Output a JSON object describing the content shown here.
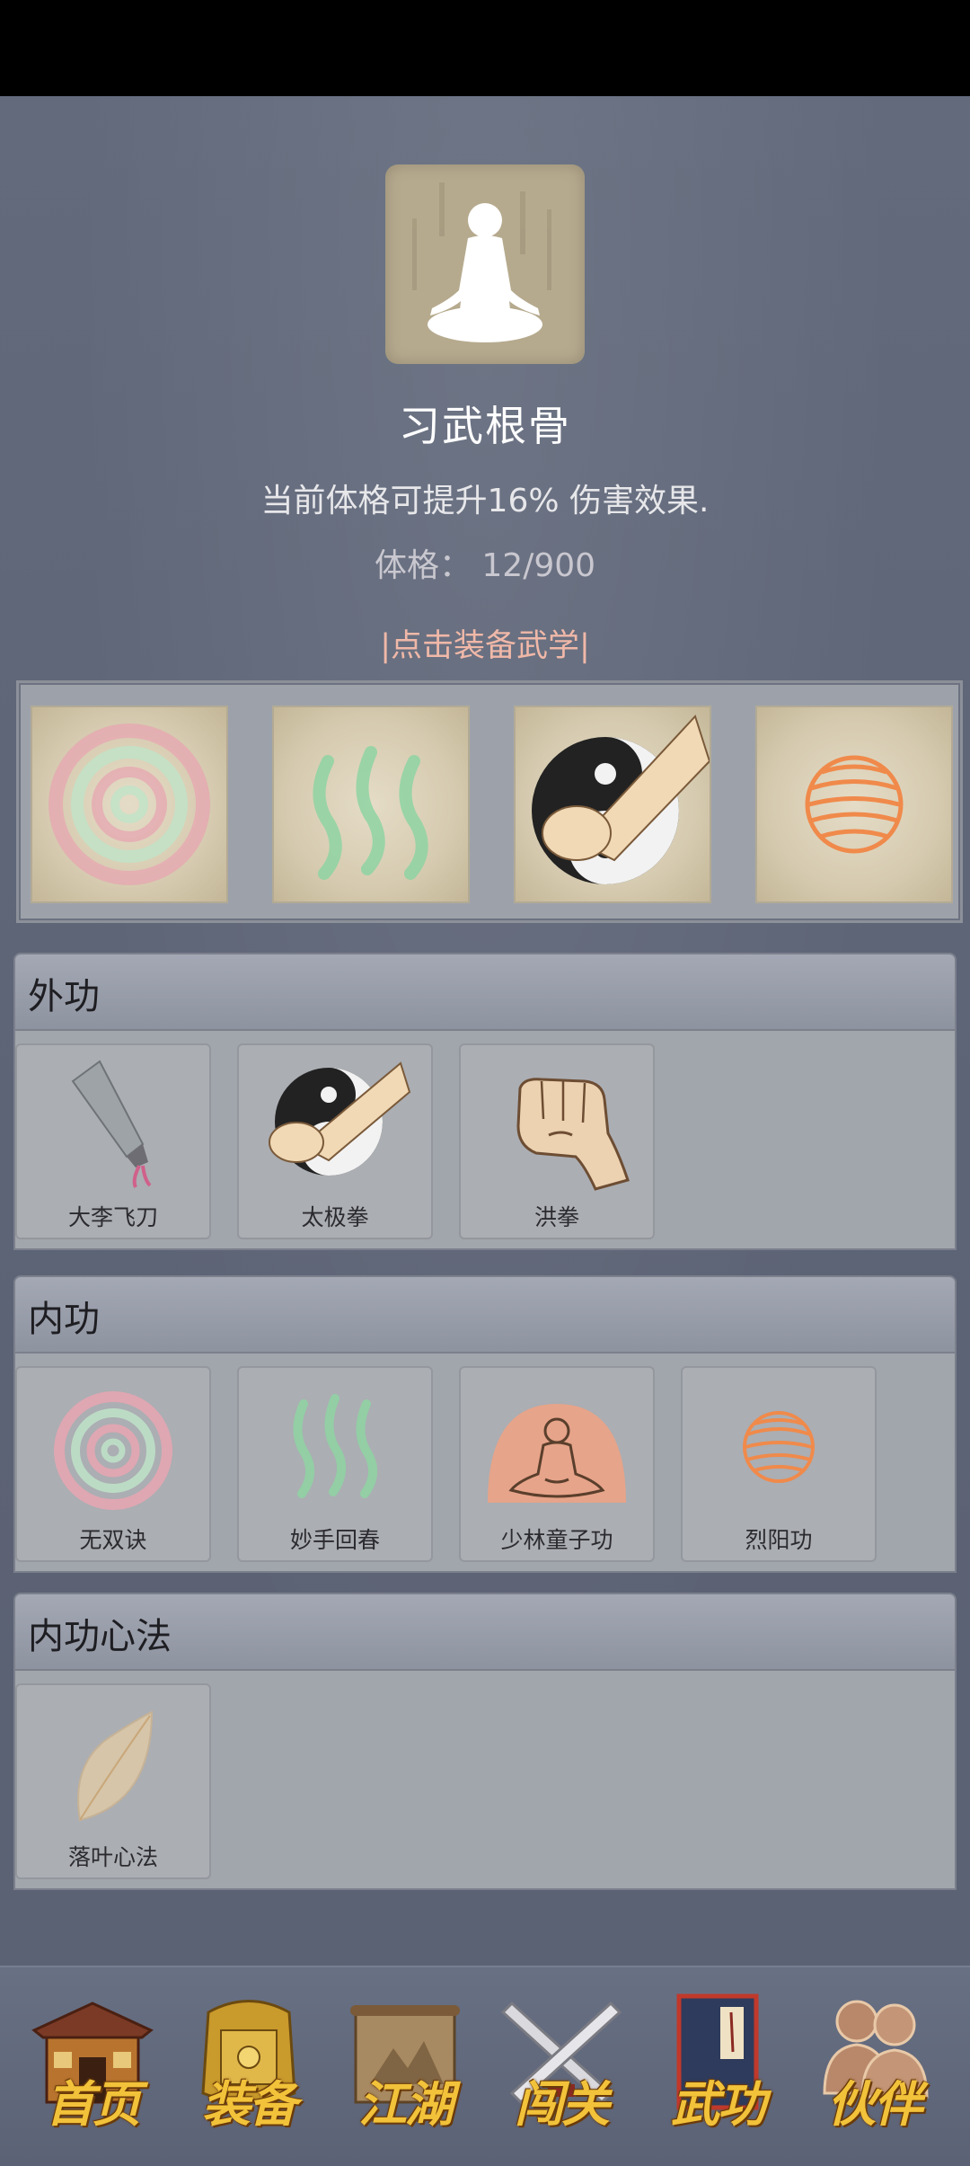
{
  "portrait": {
    "icon": "meditating-figure-icon"
  },
  "title": "习武根骨",
  "description": "当前体格可提升16% 伤害效果.",
  "stat": {
    "label": "体格：",
    "value": "12/900"
  },
  "equip_hint": "|点击装备武学|",
  "equipped": [
    {
      "icon": "spiral-icon"
    },
    {
      "icon": "wind-waves-icon"
    },
    {
      "icon": "taiji-fist-icon"
    },
    {
      "icon": "sun-orb-icon"
    }
  ],
  "sections": [
    {
      "title": "外功",
      "skills": [
        {
          "name": "大李飞刀",
          "icon": "flying-dagger-icon"
        },
        {
          "name": "太极拳",
          "icon": "taiji-fist-icon"
        },
        {
          "name": "洪拳",
          "icon": "fist-icon"
        }
      ]
    },
    {
      "title": "内功",
      "skills": [
        {
          "name": "无双诀",
          "icon": "spiral-icon"
        },
        {
          "name": "妙手回春",
          "icon": "wind-waves-icon"
        },
        {
          "name": "少林童子功",
          "icon": "monk-aura-icon"
        },
        {
          "name": "烈阳功",
          "icon": "sun-orb-icon"
        }
      ]
    },
    {
      "title": "内功心法",
      "skills": [
        {
          "name": "落叶心法",
          "icon": "leaf-icon"
        }
      ]
    }
  ],
  "nav": [
    {
      "label": "首页",
      "icon": "house-icon"
    },
    {
      "label": "装备",
      "icon": "armor-icon"
    },
    {
      "label": "江湖",
      "icon": "scroll-icon"
    },
    {
      "label": "闯关",
      "icon": "crossed-swords-icon"
    },
    {
      "label": "武功",
      "icon": "book-icon"
    },
    {
      "label": "伙伴",
      "icon": "companions-icon"
    }
  ]
}
